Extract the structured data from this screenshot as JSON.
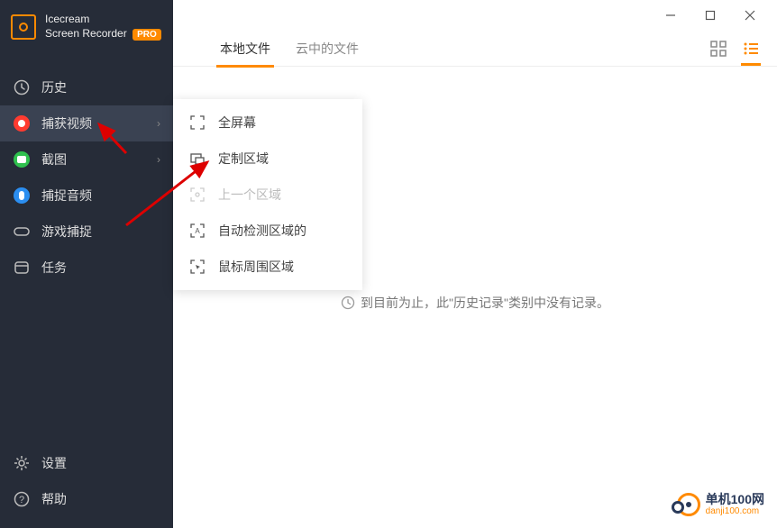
{
  "app": {
    "name_line1": "Icecream",
    "name_line2": "Screen Recorder",
    "pro_badge": "PRO"
  },
  "sidebar": {
    "items": [
      {
        "label": "历史"
      },
      {
        "label": "捕获视频"
      },
      {
        "label": "截图"
      },
      {
        "label": "捕捉音频"
      },
      {
        "label": "游戏捕捉"
      },
      {
        "label": "任务"
      }
    ],
    "bottom": [
      {
        "label": "设置"
      },
      {
        "label": "帮助"
      }
    ]
  },
  "tabs": {
    "local": "本地文件",
    "cloud": "云中的文件"
  },
  "submenu": {
    "items": [
      {
        "label": "全屏幕"
      },
      {
        "label": "定制区域"
      },
      {
        "label": "上一个区域"
      },
      {
        "label": "自动检测区域的"
      },
      {
        "label": "鼠标周围区域"
      }
    ]
  },
  "empty_message": "到目前为止，此\"历史记录\"类别中没有记录。",
  "watermark": {
    "line1": "单机100网",
    "line2": "danji100.com"
  }
}
